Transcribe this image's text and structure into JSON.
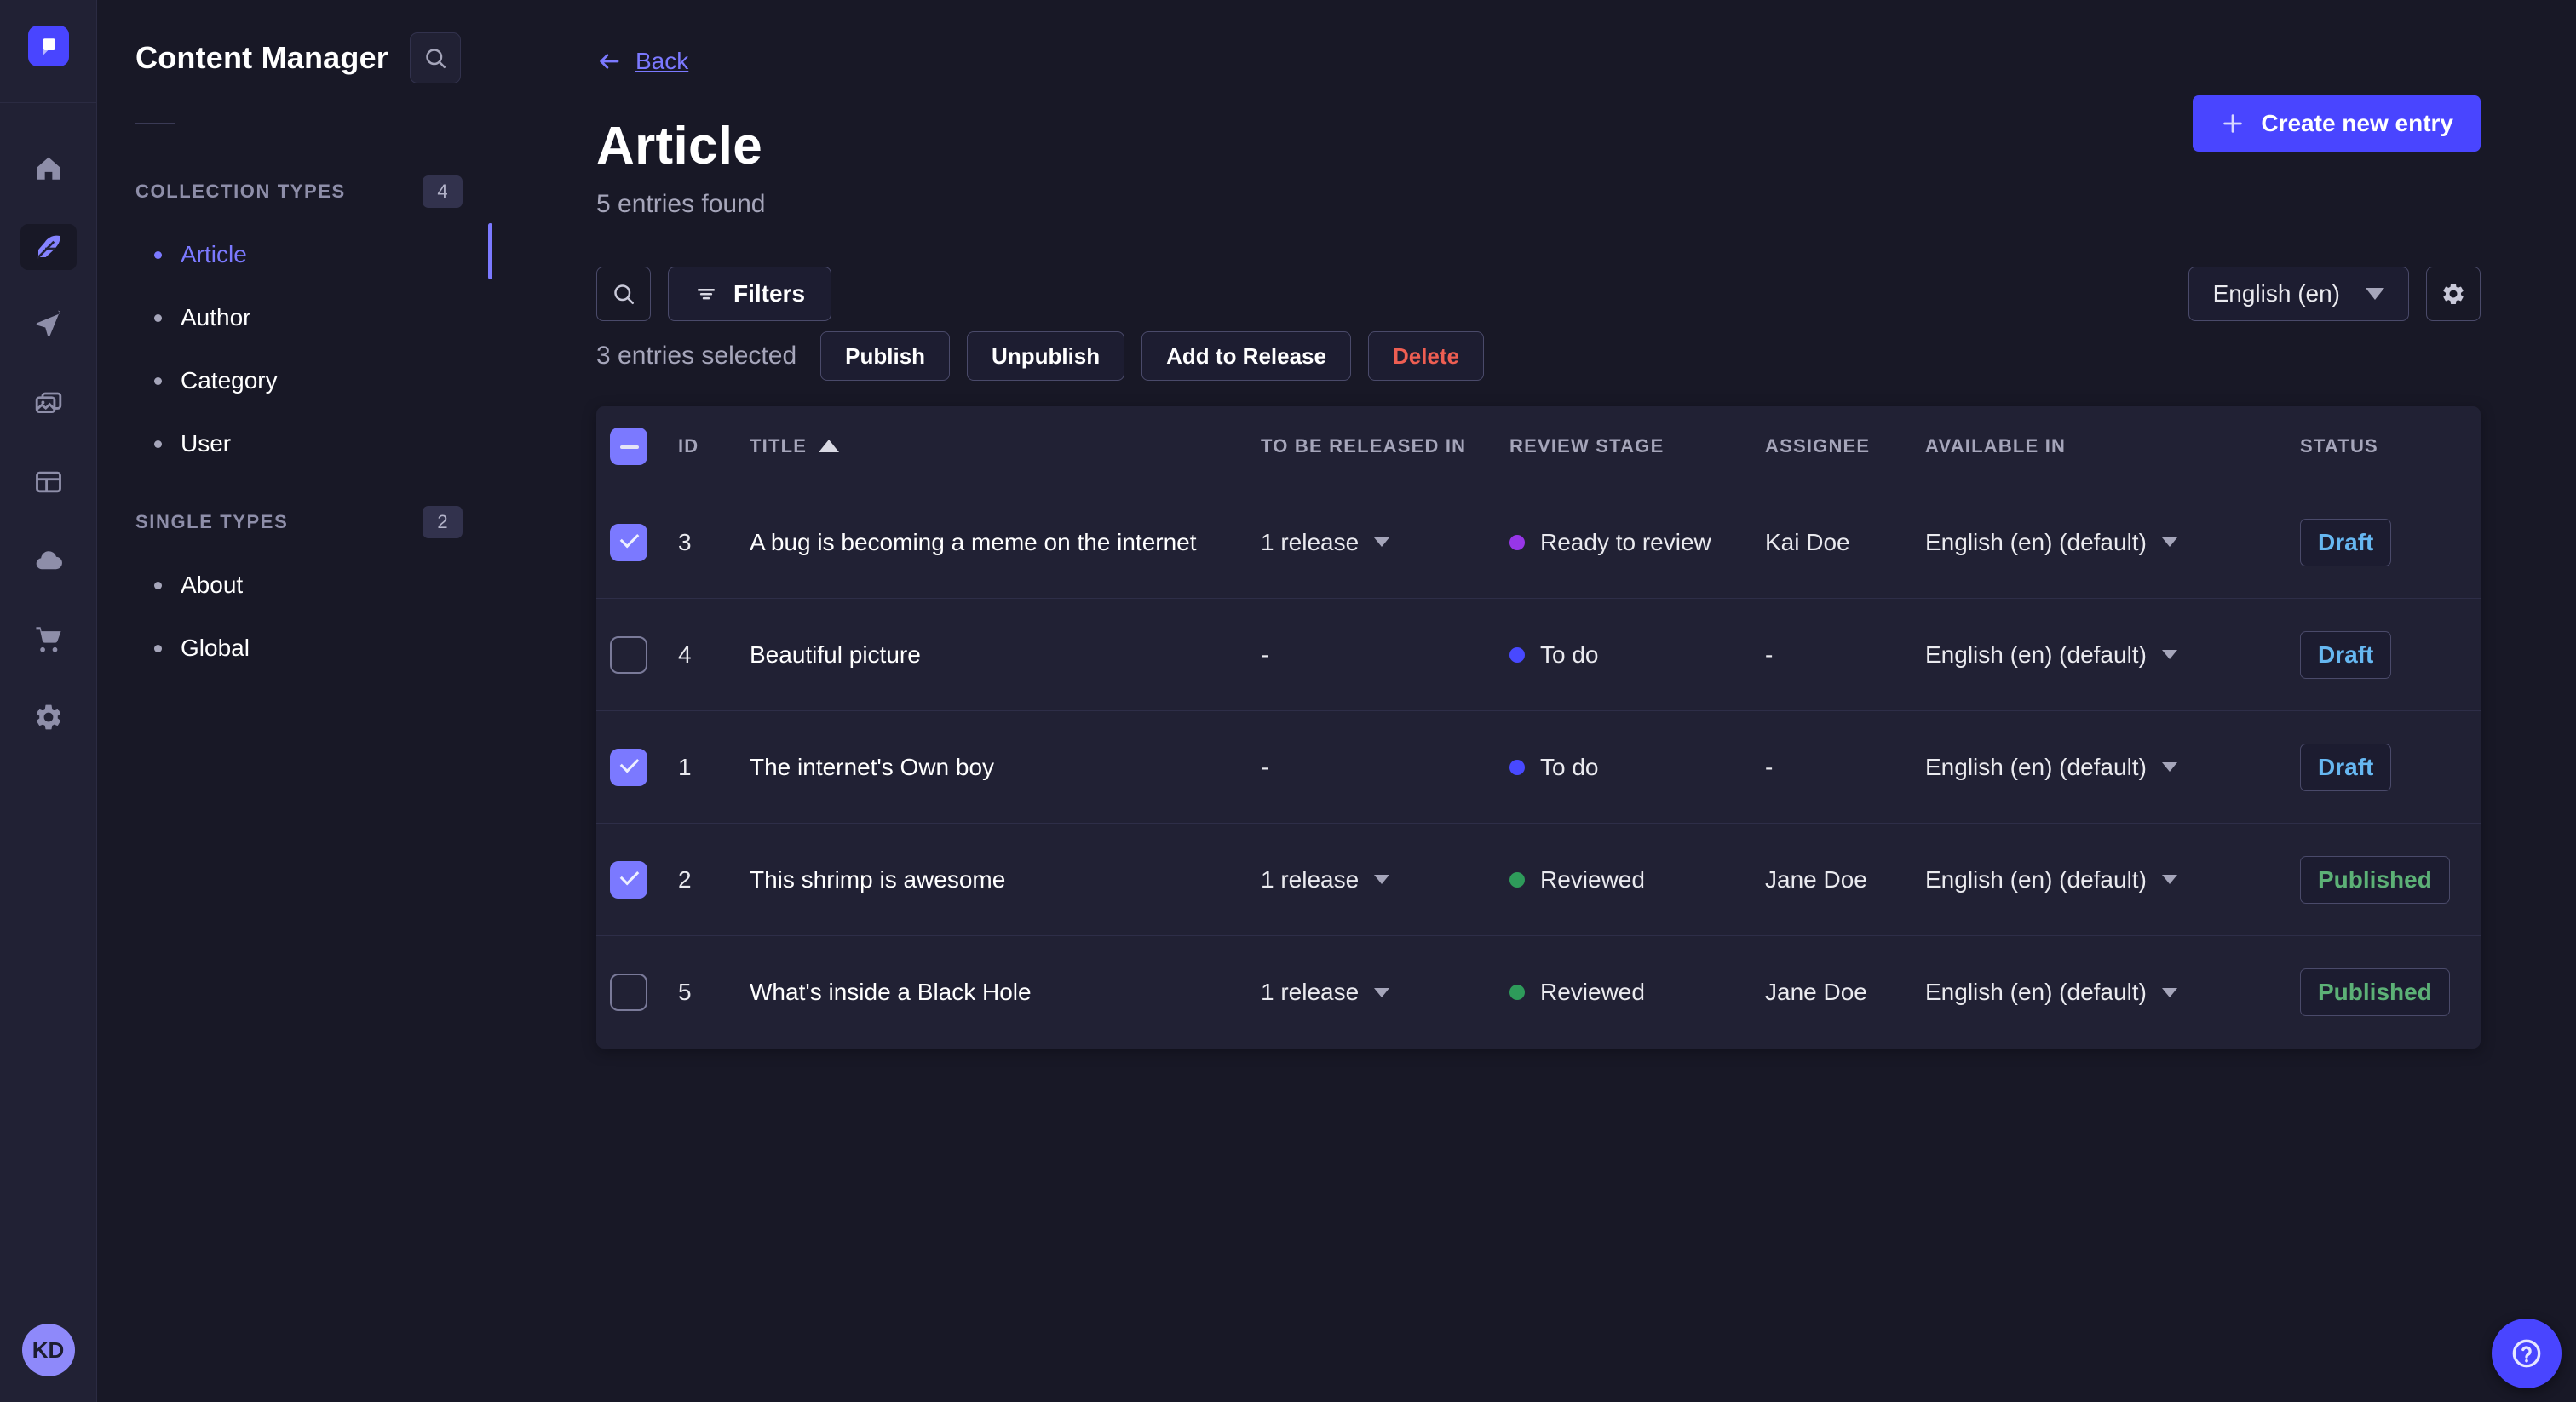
{
  "colors": {
    "primary": "#4945ff",
    "link": "#7b79ff",
    "draft_text": "#66b7f1",
    "published_text": "#5cb176",
    "danger_text": "#ee5e52",
    "dot_todo": "#4849ff",
    "dot_ready_to_review": "#9736e8",
    "dot_reviewed": "#2e9b5a"
  },
  "rail": {
    "logo_icon": "strapi-logo",
    "items": [
      {
        "name": "home-icon",
        "active": false
      },
      {
        "name": "content-manager-icon",
        "active": true
      },
      {
        "name": "releases-icon",
        "active": false
      },
      {
        "name": "media-library-icon",
        "active": false
      },
      {
        "name": "content-type-builder-icon",
        "active": false
      },
      {
        "name": "cloud-icon",
        "active": false
      },
      {
        "name": "marketplace-icon",
        "active": false
      },
      {
        "name": "settings-icon",
        "active": false
      }
    ],
    "avatar_initials": "KD"
  },
  "subnav": {
    "title": "Content Manager",
    "search_icon": "search-icon",
    "sections": [
      {
        "label": "COLLECTION TYPES",
        "badge": "4",
        "items": [
          {
            "label": "Article",
            "active": true
          },
          {
            "label": "Author",
            "active": false
          },
          {
            "label": "Category",
            "active": false
          },
          {
            "label": "User",
            "active": false
          }
        ]
      },
      {
        "label": "SINGLE TYPES",
        "badge": "2",
        "items": [
          {
            "label": "About",
            "active": false
          },
          {
            "label": "Global",
            "active": false
          }
        ]
      }
    ]
  },
  "header": {
    "back_label": "Back",
    "title": "Article",
    "subtitle": "5 entries found",
    "create_button": "Create new entry"
  },
  "controls": {
    "filters_label": "Filters",
    "locale_value": "English (en)"
  },
  "selection": {
    "summary": "3 entries selected",
    "actions": [
      "Publish",
      "Unpublish",
      "Add to Release",
      "Delete"
    ]
  },
  "table": {
    "columns": [
      "ID",
      "TITLE",
      "TO BE RELEASED IN",
      "REVIEW STAGE",
      "ASSIGNEE",
      "AVAILABLE IN",
      "STATUS"
    ],
    "sorted_column": "TITLE",
    "header_checkbox_state": "indeterminate",
    "rows": [
      {
        "checked": true,
        "id": "3",
        "title": "A bug is becoming a meme on the internet",
        "release": "1 release",
        "review_stage": "Ready to review",
        "review_color": "#9736e8",
        "assignee": "Kai Doe",
        "available": "English (en) (default)",
        "status": "Draft"
      },
      {
        "checked": false,
        "id": "4",
        "title": "Beautiful picture",
        "release": "-",
        "review_stage": "To do",
        "review_color": "#4849ff",
        "assignee": "-",
        "available": "English (en) (default)",
        "status": "Draft"
      },
      {
        "checked": true,
        "id": "1",
        "title": "The internet's Own boy",
        "release": "-",
        "review_stage": "To do",
        "review_color": "#4849ff",
        "assignee": "-",
        "available": "English (en) (default)",
        "status": "Draft"
      },
      {
        "checked": true,
        "id": "2",
        "title": "This shrimp is awesome",
        "release": "1 release",
        "review_stage": "Reviewed",
        "review_color": "#2e9b5a",
        "assignee": "Jane Doe",
        "available": "English (en) (default)",
        "status": "Published"
      },
      {
        "checked": false,
        "id": "5",
        "title": "What's inside a Black Hole",
        "release": "1 release",
        "review_stage": "Reviewed",
        "review_color": "#2e9b5a",
        "assignee": "Jane Doe",
        "available": "English (en) (default)",
        "status": "Published"
      }
    ]
  }
}
